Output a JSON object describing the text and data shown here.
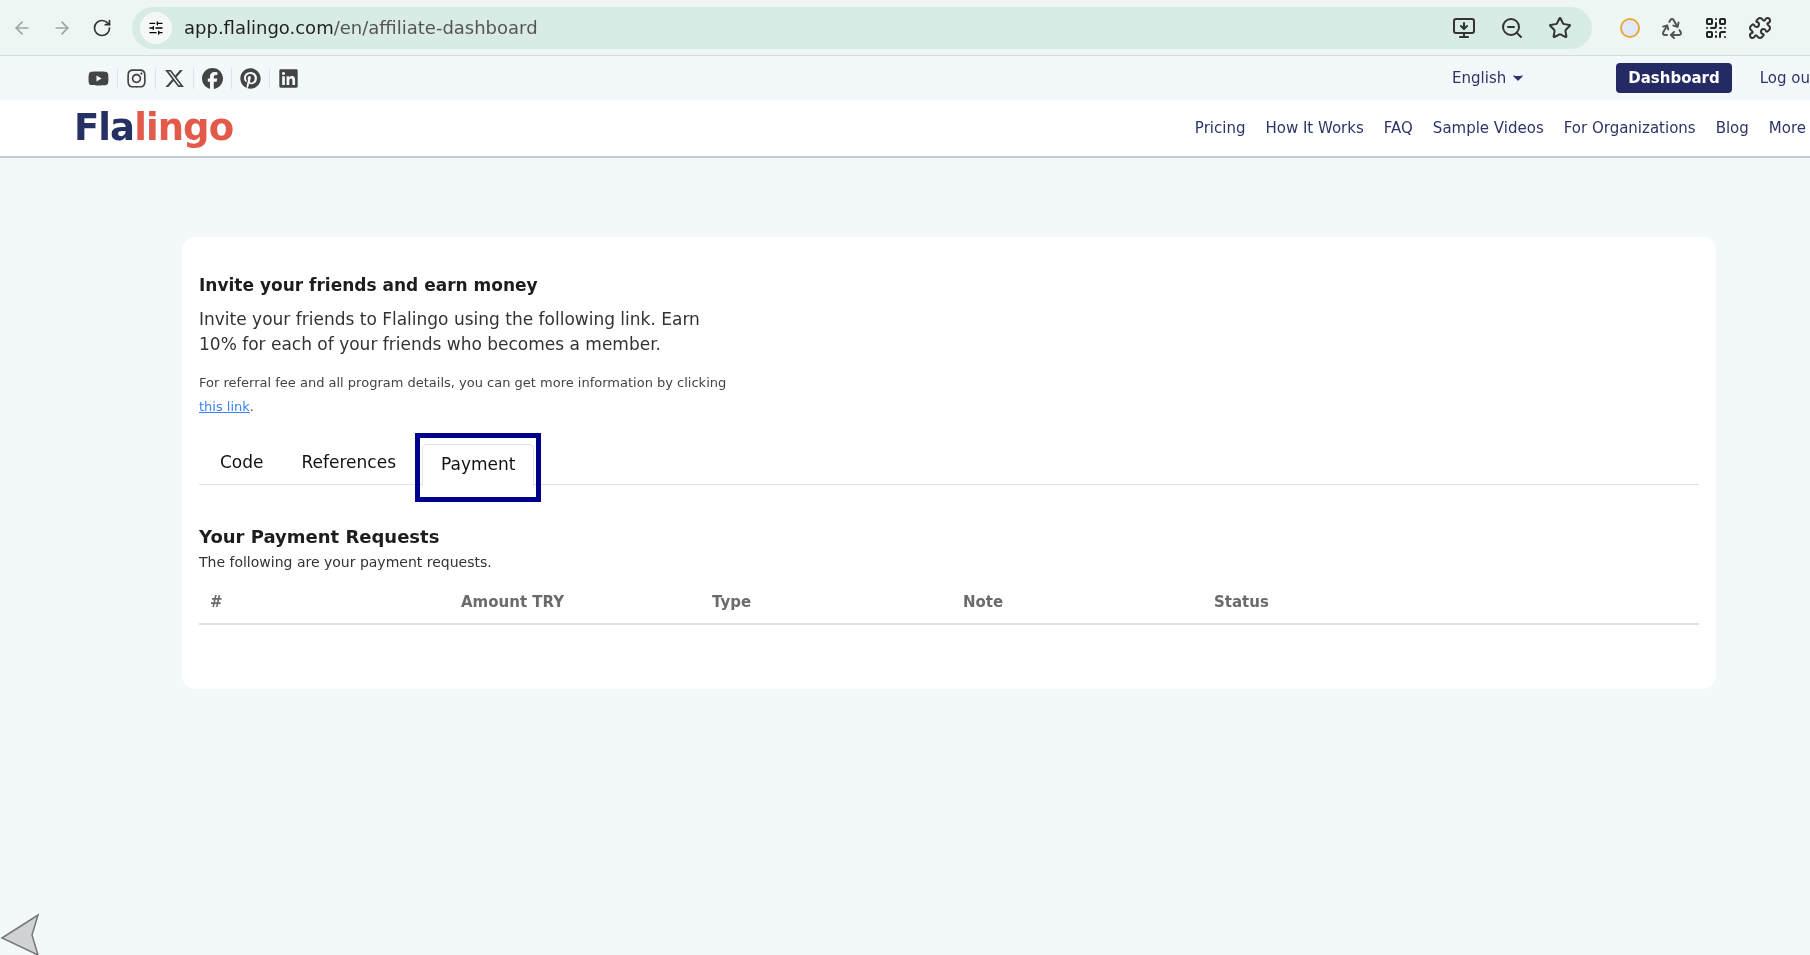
{
  "browser": {
    "url_host": "app.flalingo.com",
    "url_path": "/en/affiliate-dashboard"
  },
  "topbar": {
    "language": "English",
    "buttons": [
      {
        "label": "Dashboard",
        "kind": "primary"
      },
      {
        "label": "Log ou",
        "kind": "link"
      }
    ]
  },
  "logo": {
    "part_1": "Fla",
    "part_2": "lingo"
  },
  "nav": [
    "Pricing",
    "How It Works",
    "FAQ",
    "Sample Videos",
    "For Organizations",
    "Blog",
    "More"
  ],
  "card": {
    "title": "Invite your friends and earn money",
    "intro": "Invite your friends to Flalingo using the following link. Earn 10% for each of your friends who becomes a member.",
    "details": "For referral fee and all program details, you can get more information by clicking",
    "details_link": "this link",
    "details_end": ".",
    "tabs": [
      {
        "label": "Code",
        "selected": false,
        "highlighted": false
      },
      {
        "label": "References",
        "selected": false,
        "highlighted": false
      },
      {
        "label": "Payment",
        "selected": true,
        "highlighted": true
      }
    ],
    "section_title": "Your Payment Requests",
    "section_subtitle": "The following are your payment requests.",
    "table": {
      "columns": [
        "#",
        "Amount TRY",
        "Type",
        "Note",
        "Status"
      ]
    }
  }
}
